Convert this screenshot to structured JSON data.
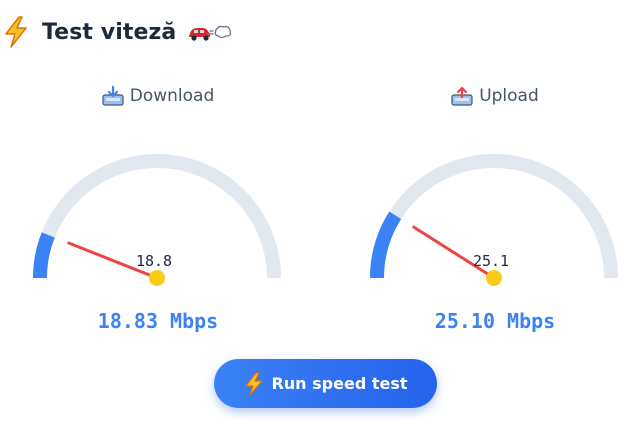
{
  "header": {
    "title": "Test viteză",
    "title_icon": "lightning-bolt-icon",
    "decor_icon": "car-speed-icon"
  },
  "gauges": [
    {
      "label": "Download",
      "icon": "download-tray-icon",
      "needle_value": "18.8",
      "speed_text": "18.83 Mbps",
      "level": 0.12
    },
    {
      "label": "Upload",
      "icon": "upload-tray-icon",
      "needle_value": "25.1",
      "speed_text": "25.10 Mbps",
      "level": 0.18
    }
  ],
  "actions": {
    "run_label": "Run speed test",
    "run_icon": "lightning-bolt-icon"
  },
  "colors": {
    "track": "#e2e8f0",
    "fill": "#3b82f6",
    "needle": "#ef4444",
    "needle_hub": "#facc15",
    "speed_text": "#3b82f6",
    "button": "#2563eb"
  }
}
